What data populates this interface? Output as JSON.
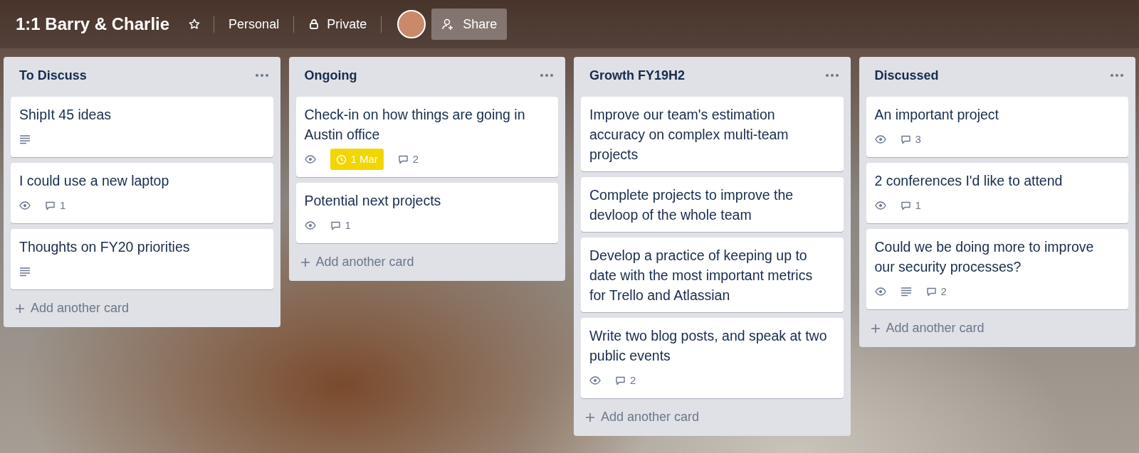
{
  "board": {
    "title": "1:1 Barry & Charlie",
    "starred": false,
    "team": "Personal",
    "visibility": "Private",
    "share": "Share"
  },
  "lists": [
    {
      "title": "To Discuss",
      "add": "Add another card",
      "cards": [
        {
          "title": "ShipIt 45 ideas",
          "badges": [
            {
              "kind": "description"
            }
          ]
        },
        {
          "title": "I could use a new laptop",
          "badges": [
            {
              "kind": "watch"
            },
            {
              "kind": "comments",
              "count": "1"
            }
          ]
        },
        {
          "title": "Thoughts on FY20 priorities",
          "badges": [
            {
              "kind": "description"
            }
          ]
        }
      ]
    },
    {
      "title": "Ongoing",
      "add": "Add another card",
      "cards": [
        {
          "title": "Check-in on how things are going in Austin office",
          "badges": [
            {
              "kind": "watch"
            },
            {
              "kind": "due",
              "text": "1 Mar"
            },
            {
              "kind": "comments",
              "count": "2"
            }
          ]
        },
        {
          "title": "Potential next projects",
          "badges": [
            {
              "kind": "watch"
            },
            {
              "kind": "comments",
              "count": "1"
            }
          ]
        }
      ]
    },
    {
      "title": "Growth FY19H2",
      "add": "Add another card",
      "cards": [
        {
          "title": "Improve our team's estimation accuracy on complex multi-team projects"
        },
        {
          "title": "Complete projects to improve the devloop of the whole team"
        },
        {
          "title": "Develop a practice of keeping up to date with the most important metrics for Trello and Atlassian"
        },
        {
          "title": "Write two blog posts, and speak at two public events",
          "badges": [
            {
              "kind": "watch"
            },
            {
              "kind": "comments",
              "count": "2"
            }
          ]
        }
      ]
    },
    {
      "title": "Discussed",
      "add": "Add another card",
      "cards": [
        {
          "title": "An important project",
          "badges": [
            {
              "kind": "watch"
            },
            {
              "kind": "comments",
              "count": "3"
            }
          ]
        },
        {
          "title": "2 conferences I'd like to attend",
          "badges": [
            {
              "kind": "watch"
            },
            {
              "kind": "comments",
              "count": "1"
            }
          ]
        },
        {
          "title": "Could we be doing more to improve our security processes?",
          "badges": [
            {
              "kind": "watch"
            },
            {
              "kind": "description"
            },
            {
              "kind": "comments",
              "count": "2"
            }
          ]
        }
      ]
    }
  ]
}
